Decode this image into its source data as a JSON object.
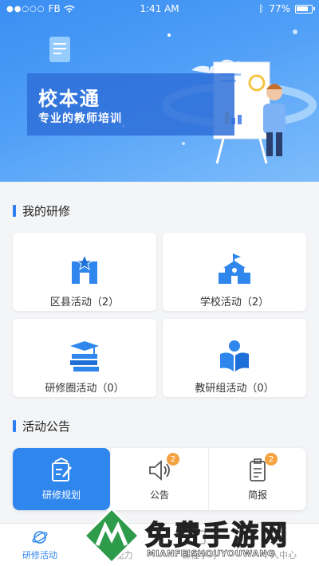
{
  "status_bar": {
    "carrier": "FB",
    "time": "1:41 AM",
    "battery": "77%"
  },
  "banner": {
    "title": "校本通",
    "subtitle": "专业的教师培训"
  },
  "my_training": {
    "title": "我的研修",
    "cards": [
      {
        "label": "区县活动（2）",
        "icon": "district-icon"
      },
      {
        "label": "学校活动（2）",
        "icon": "school-icon"
      },
      {
        "label": "研修圈活动（0）",
        "icon": "book-stack-icon"
      },
      {
        "label": "教研组活动（0）",
        "icon": "reading-person-icon"
      }
    ]
  },
  "announcements": {
    "title": "活动公告",
    "tabs": [
      {
        "label": "研修规划",
        "active": true
      },
      {
        "label": "公告",
        "badge": "2"
      },
      {
        "label": "简报",
        "badge": "2"
      }
    ]
  },
  "bottom_nav": [
    {
      "label": "研修活动",
      "active": true
    },
    {
      "label": "我能力"
    },
    {
      "label": "课程学习"
    },
    {
      "label": "个人中心"
    }
  ],
  "watermark": {
    "text": "免费手游网",
    "sub": "MIANFEISHOUYOUWANG"
  },
  "colors": {
    "accent": "#2f86ec",
    "badge": "#f5a341",
    "background": "#f4f5f7"
  }
}
